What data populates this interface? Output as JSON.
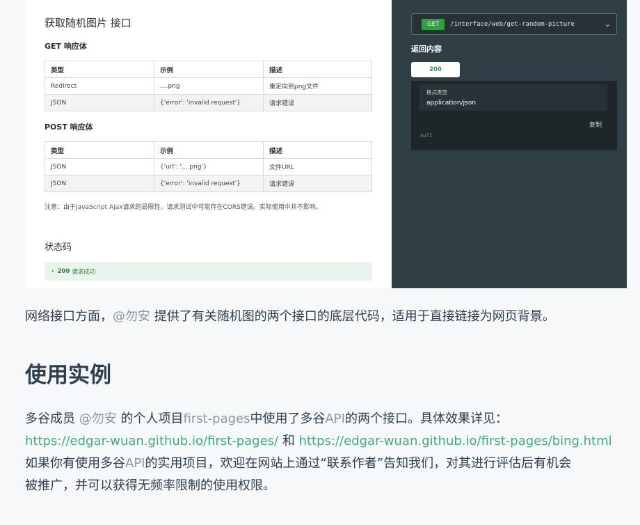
{
  "screenshot": {
    "api_title": "获取随机图片 接口",
    "get_section": "GET 响应体",
    "post_section": "POST 响应体",
    "headers": [
      "类型",
      "示例",
      "描述"
    ],
    "get_rows": [
      [
        "Redirect",
        "....png",
        "重定向到png文件"
      ],
      [
        "JSON",
        "{'error': 'invalid request'}",
        "请求错误"
      ]
    ],
    "post_rows": [
      [
        "JSON",
        "{'url': '....png'}",
        "文件URL"
      ],
      [
        "JSON",
        "{'error': 'invalid request'}",
        "请求错误"
      ]
    ],
    "note": "注意：由于JavaScript Ajax请求的局限性，请求测试中可能存在CORS错误。实际使用中并不影响。",
    "status_title": "状态码",
    "status_code": "200",
    "status_text": "请求成功",
    "method": "GET",
    "path": "/interface/web/get-random-picture",
    "return_title": "返回内容",
    "tab_label": "200",
    "format_label": "格式类型",
    "format_value": "application/json",
    "copy_label": "复制",
    "body_value": "null"
  },
  "article": {
    "p1_a": "网络接口方面，",
    "p1_author": "@勿安",
    "p1_b": " 提供了有关随机图的两个接口的底层代码，适用于直接链接为网页背景。",
    "heading": "使用实例",
    "p2_a": "多谷成员 ",
    "p2_author": "@勿安",
    "p2_b": " 的个人项目",
    "p2_project": "first-pages",
    "p2_c": "中使用了多谷",
    "p2_api": "API",
    "p2_d": "的两个接口。具体效果详见：",
    "link1": "https://edgar-wuan.github.io/first-pages/",
    "and": " 和 ",
    "link2": "https://edgar-wuan.github.io/first-pages/bing.html",
    "p3_a": "如果你有使用多谷",
    "p3_api": "API",
    "p3_b": "的实用项目，欢迎在网站上通过“联系作者”告知我们，对其进行评估后有机会",
    "p4": "被推广，并可以获得无频率限制的使用权限。"
  }
}
